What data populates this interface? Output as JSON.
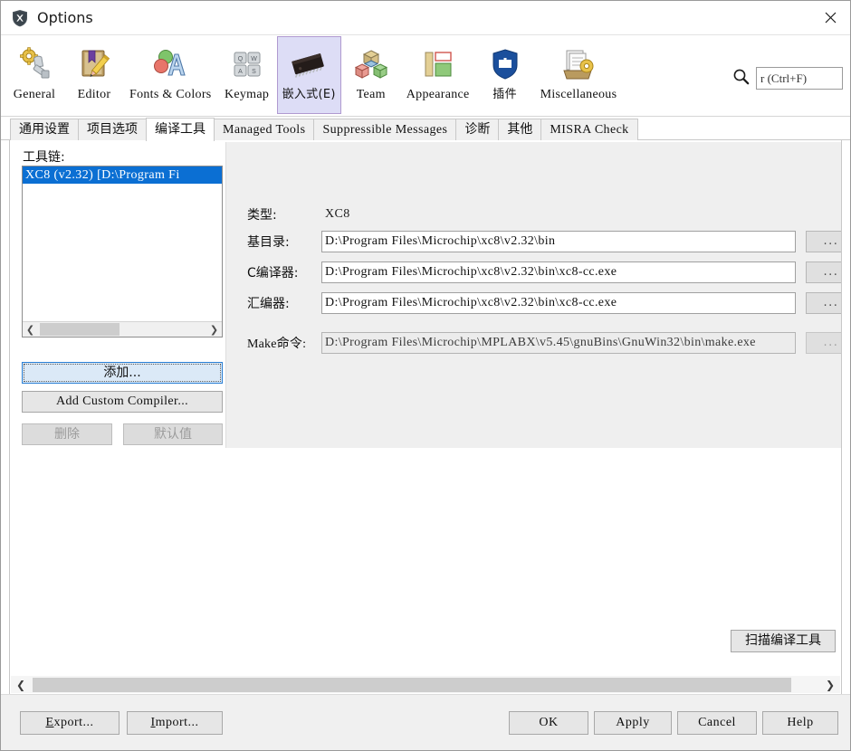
{
  "window": {
    "title": "Options",
    "icon": "options-shield-icon",
    "close_label": "✕"
  },
  "search": {
    "icon": "search-icon",
    "value": "r (Ctrl+F)"
  },
  "categories": [
    {
      "label": "General",
      "icon": "gear-wrench-icon",
      "selected": false,
      "cjk": false
    },
    {
      "label": "Editor",
      "icon": "book-pencil-icon",
      "selected": false,
      "cjk": false
    },
    {
      "label": "Fonts & Colors",
      "icon": "font-palette-icon",
      "selected": false,
      "cjk": false
    },
    {
      "label": "Keymap",
      "icon": "keyboard-keys-icon",
      "selected": false,
      "cjk": false
    },
    {
      "label": "嵌入式(E)",
      "icon": "chip-icon",
      "selected": true,
      "cjk": true
    },
    {
      "label": "Team",
      "icon": "team-cubes-icon",
      "selected": false,
      "cjk": false
    },
    {
      "label": "Appearance",
      "icon": "layout-panels-icon",
      "selected": false,
      "cjk": false
    },
    {
      "label": "插件",
      "icon": "plugin-shield-icon",
      "selected": true,
      "cjk": true
    },
    {
      "label": "Miscellaneous",
      "icon": "misc-docs-gear-icon",
      "selected": false,
      "cjk": false
    }
  ],
  "tabs": [
    {
      "label": "通用设置",
      "active": false,
      "latin": false
    },
    {
      "label": "项目选项",
      "active": false,
      "latin": false
    },
    {
      "label": "编译工具",
      "active": true,
      "latin": false
    },
    {
      "label": "Managed Tools",
      "active": false,
      "latin": true
    },
    {
      "label": "Suppressible Messages",
      "active": false,
      "latin": true
    },
    {
      "label": "诊断",
      "active": false,
      "latin": false
    },
    {
      "label": "其他",
      "active": false,
      "latin": false
    },
    {
      "label": "MISRA Check",
      "active": false,
      "latin": true
    }
  ],
  "toolchain": {
    "label": "工具链:",
    "items": [
      {
        "text": "XC8 (v2.32) [D:\\Program Fi",
        "selected": true
      }
    ],
    "scroll_left_icon": "chevron-left-icon",
    "scroll_right_icon": "chevron-right-icon"
  },
  "toolchain_buttons": {
    "add": "添加...",
    "add_custom": "Add Custom Compiler...",
    "delete": "删除",
    "defaults": "默认值"
  },
  "form": {
    "rows": [
      {
        "label": "类型:",
        "kind": "static",
        "value": "XC8"
      },
      {
        "label": "基目录:",
        "kind": "input",
        "value": "D:\\Program Files\\Microchip\\xc8\\v2.32\\bin",
        "browse": "...",
        "browse_dim": false
      },
      {
        "label": "C编译器:",
        "kind": "input",
        "value": "D:\\Program Files\\Microchip\\xc8\\v2.32\\bin\\xc8-cc.exe",
        "browse": "...",
        "browse_dim": false
      },
      {
        "label": "汇编器:",
        "kind": "input",
        "value": "D:\\Program Files\\Microchip\\xc8\\v2.32\\bin\\xc8-cc.exe",
        "browse": "...",
        "browse_dim": false
      },
      {
        "label": "Make命令:",
        "kind": "input-readonly",
        "value": "D:\\Program Files\\Microchip\\MPLABX\\v5.45\\gnuBins\\GnuWin32\\bin\\make.exe",
        "browse": "...",
        "browse_dim": true
      }
    ]
  },
  "scan_button": "扫描编译工具",
  "content_scrollbar": {
    "left_icon": "chevron-left-icon",
    "right_icon": "chevron-right-icon"
  },
  "footer": {
    "export": "Export...",
    "export_accel": "E",
    "import": "Import...",
    "import_accel": "I",
    "ok": "OK",
    "apply": "Apply",
    "cancel": "Cancel",
    "help": "Help"
  },
  "colors": {
    "selection_blue": "#0b6fd3",
    "selected_category": "#ddddf6",
    "selected_category_border": "#b09ad0",
    "panel_gray": "#efefef",
    "footer_gray": "#f0f0f0",
    "focus_blue": "#2a7fd4"
  }
}
